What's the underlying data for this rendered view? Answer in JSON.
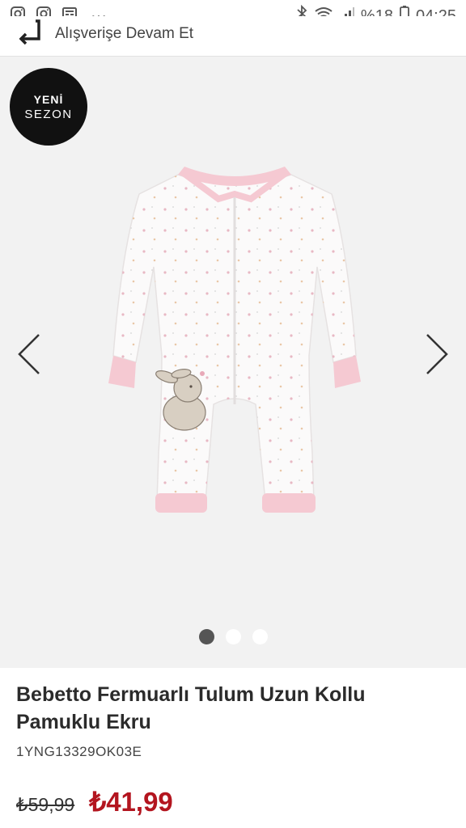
{
  "status_bar": {
    "icons_left": [
      "instagram-icon",
      "instagram-icon",
      "news-icon",
      "more-icon"
    ],
    "more_glyph": "···",
    "battery_pct": "%18",
    "time": "04:25",
    "icons_right": [
      "bluetooth-icon",
      "wifi-icon",
      "signal-icon",
      "battery-icon"
    ]
  },
  "header": {
    "continue_label": "Alışverişe Devam Et"
  },
  "gallery": {
    "badge_line1": "YENİ",
    "badge_line2": "SEZON",
    "image_alt": "Bebetto Fermuarlı Tulum Uzun Kollu Pamuklu Ekru",
    "dots": [
      {
        "active": true
      },
      {
        "active": false
      },
      {
        "active": false
      }
    ]
  },
  "product": {
    "title": "Bebetto Fermuarlı Tulum Uzun Kollu Pamuklu Ekru",
    "sku": "1YNG13329OK03E",
    "old_price": "₺59,99",
    "new_price": "₺41,99"
  },
  "colors": {
    "price_red": "#b3151f",
    "badge_black": "#111111",
    "image_bg": "#f2f2f2",
    "romper_pink": "#f5c9d2"
  }
}
